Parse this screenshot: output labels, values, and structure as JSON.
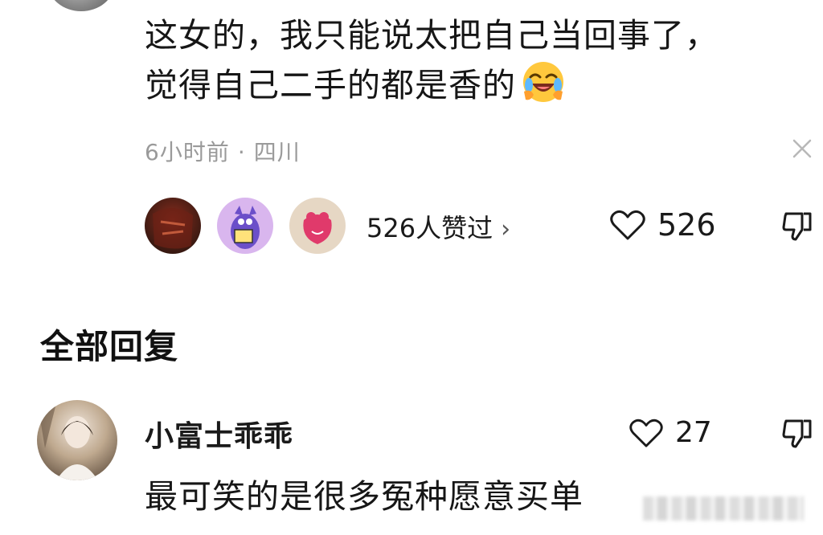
{
  "comment": {
    "line1": "这女的，我只能说太把自己当回事了，",
    "line2": "觉得自己二手的都是香的",
    "emoji": "laughing-face-emoji",
    "time": "6小时前",
    "dot": "·",
    "location": "四川"
  },
  "likers": {
    "summary": "526人赞过",
    "chevron": "›"
  },
  "like": {
    "count": "526"
  },
  "section": {
    "title": "全部回复"
  },
  "reply": {
    "name": "小富士乖乖",
    "like_count": "27",
    "text": "最可笑的是很多冤种愿意买单"
  },
  "colors": {
    "text": "#161616",
    "meta": "#9a9a9a",
    "background": "#ffffff"
  }
}
